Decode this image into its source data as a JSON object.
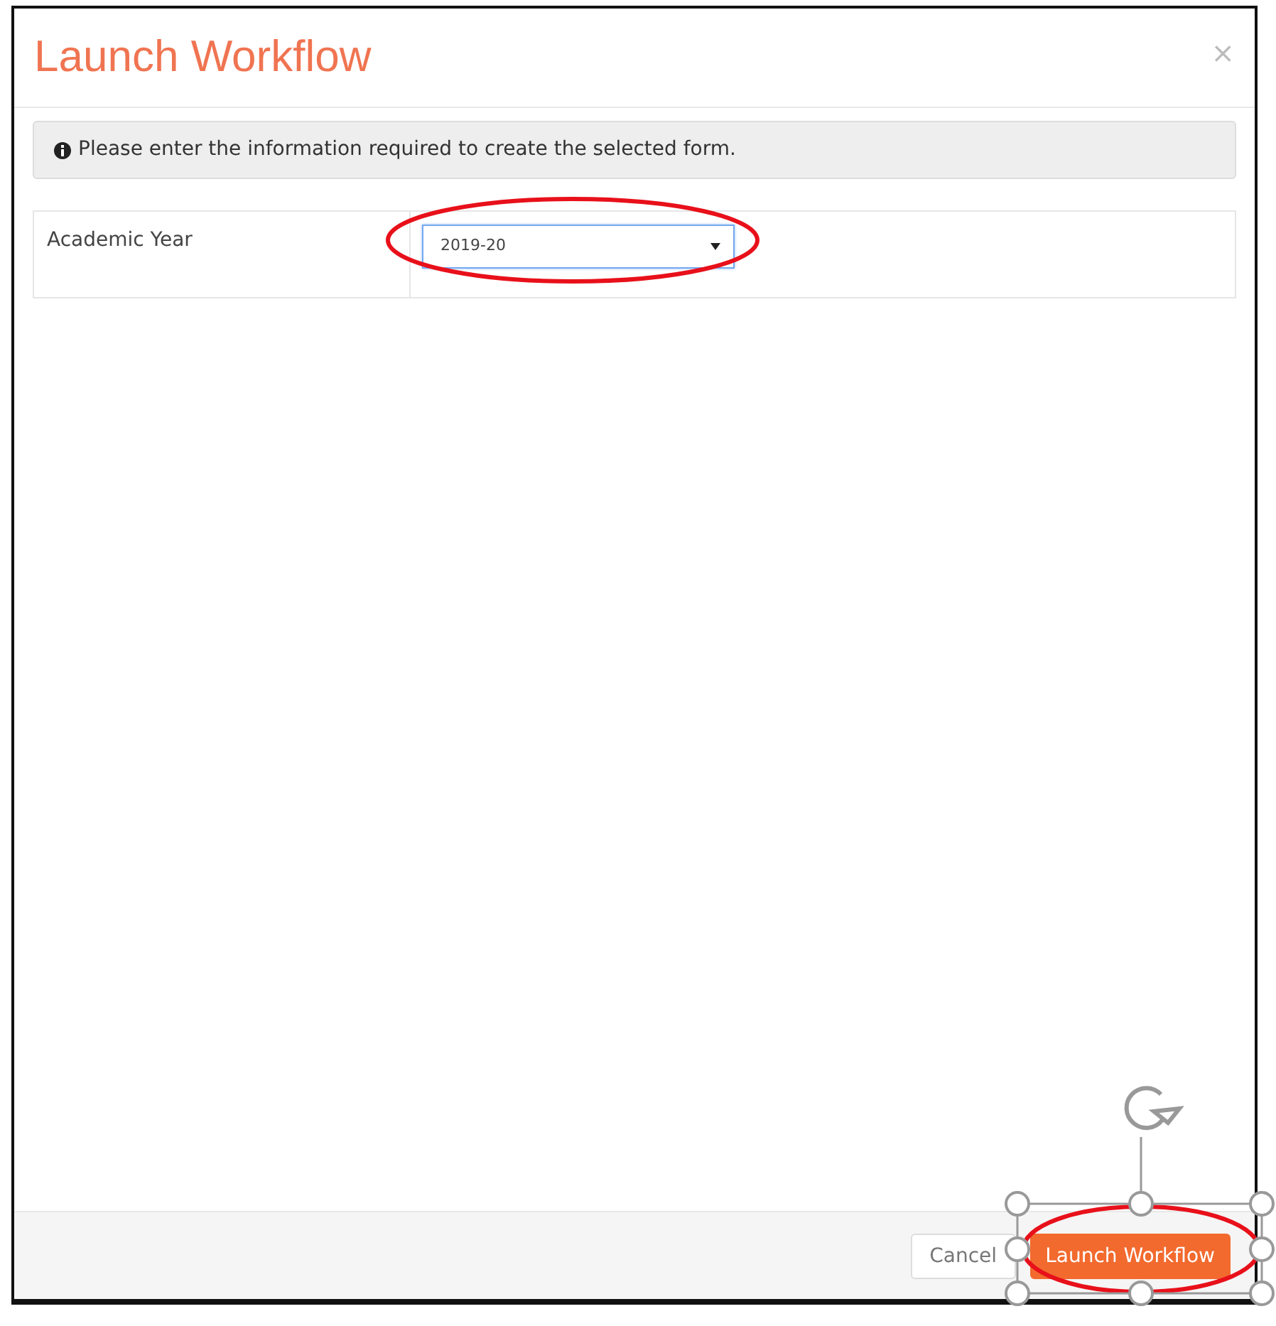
{
  "dialog": {
    "title": "Launch Workflow",
    "close": "×",
    "info": "Please enter the information required to create the selected form.",
    "fields": [
      {
        "label": "Academic Year",
        "value": "2019-20"
      }
    ],
    "buttons": [
      {
        "label": "Cancel",
        "kind": "secondary"
      },
      {
        "label": "Launch Workflow",
        "kind": "primary"
      }
    ]
  }
}
